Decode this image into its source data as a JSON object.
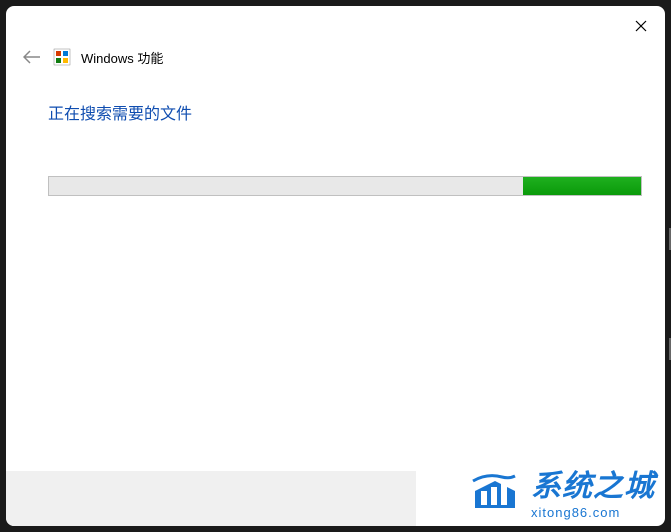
{
  "window": {
    "title": "Windows 功能"
  },
  "content": {
    "status_text": "正在搜索需要的文件",
    "progress_percent": 20
  },
  "watermark": {
    "title": "系统之城",
    "url": "xitong86.com"
  }
}
